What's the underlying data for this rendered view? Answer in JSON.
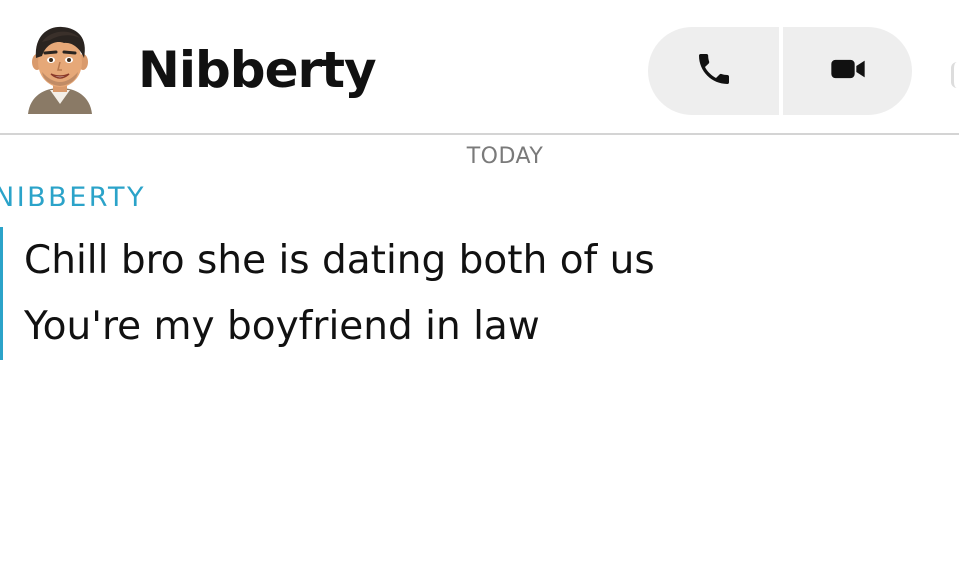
{
  "header": {
    "contact_name": "Nibberty",
    "avatar_icon": "bitmoji-avatar-icon",
    "voice_call_icon": "phone-icon",
    "video_call_icon": "video-camera-icon"
  },
  "chat": {
    "date_label": "TODAY",
    "sender_label": "NIBBERTY",
    "accent_color": "#2ba3c9",
    "messages": [
      {
        "text": "Chill bro she is dating both of us"
      },
      {
        "text": "You're my boyfriend in law"
      }
    ]
  }
}
